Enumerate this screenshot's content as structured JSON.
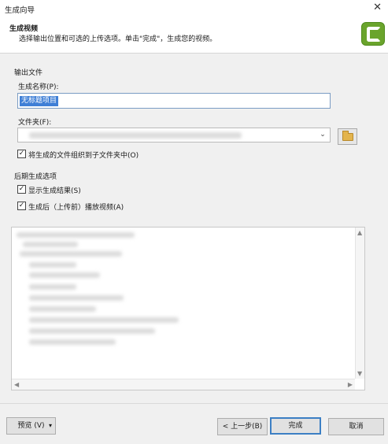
{
  "window": {
    "title": "生成向导"
  },
  "header": {
    "title": "生成视频",
    "subtitle": "选择输出位置和可选的上传选项。单击\"完成\"，生成您的视频。"
  },
  "output": {
    "group_label": "输出文件",
    "name_label": "生成名称(P):",
    "name_value": "无标题项目",
    "folder_label": "文件夹(F):",
    "organize_label": "将生成的文件组织到子文件夹中(O)",
    "organize_checked": "✓"
  },
  "post": {
    "group_label": "后期生成选项",
    "show_results_label": "显示生成结果(S)",
    "show_results_checked": "✓",
    "play_label": "生成后（上传前）播放视频(A)",
    "play_checked": "✓"
  },
  "buttons": {
    "preview": "预览 (V)",
    "back": "< 上一步(B)",
    "finish": "完成",
    "cancel": "取消"
  }
}
